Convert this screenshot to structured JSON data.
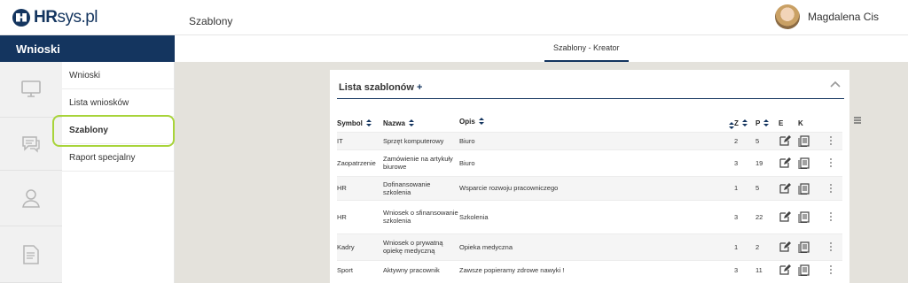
{
  "brand": {
    "hr": "HR",
    "rest": "sys.pl"
  },
  "section_title": "Wnioski",
  "header": {
    "title": "Szablony",
    "user_name": "Magdalena Cis"
  },
  "tab": {
    "label": "Szablony - Kreator"
  },
  "submenu": [
    {
      "label": "Wnioski"
    },
    {
      "label": "Lista wniosków"
    },
    {
      "label": "Szablony"
    },
    {
      "label": "Raport specjalny"
    }
  ],
  "rail_icons": [
    "monitor-icon",
    "chat-icon",
    "user-icon",
    "document-icon"
  ],
  "panel": {
    "title": "Lista szablonów",
    "add": "+"
  },
  "table": {
    "columns": [
      "Symbol",
      "Nazwa",
      "Opis",
      "Z",
      "P",
      "E",
      "K"
    ],
    "rows": [
      {
        "symbol": "IT",
        "nazwa": "Sprzęt komputerowy",
        "opis": "Biuro",
        "z": "2",
        "p": "5"
      },
      {
        "symbol": "Zaopatrzenie",
        "nazwa": "Zamówienie na artykuły biurowe",
        "opis": "Biuro",
        "z": "3",
        "p": "19"
      },
      {
        "symbol": "HR",
        "nazwa": "Dofinansowanie szkolenia",
        "opis": "Wsparcie rozwoju pracowniczego",
        "z": "1",
        "p": "5"
      },
      {
        "symbol": "HR",
        "nazwa": "Wniosek o sfinansowanie szkolenia",
        "opis": "Szkolenia",
        "z": "3",
        "p": "22"
      },
      {
        "symbol": "Kadry",
        "nazwa": "Wniosek o prywatną opiekę medyczną",
        "opis": "Opieka medyczna",
        "z": "1",
        "p": "2"
      },
      {
        "symbol": "Sport",
        "nazwa": "Aktywny pracownik",
        "opis": "Zawsze popieramy zdrowe nawyki !",
        "z": "3",
        "p": "11"
      }
    ]
  },
  "colors": {
    "brand": "#14355f",
    "highlight": "#a8d43a"
  }
}
